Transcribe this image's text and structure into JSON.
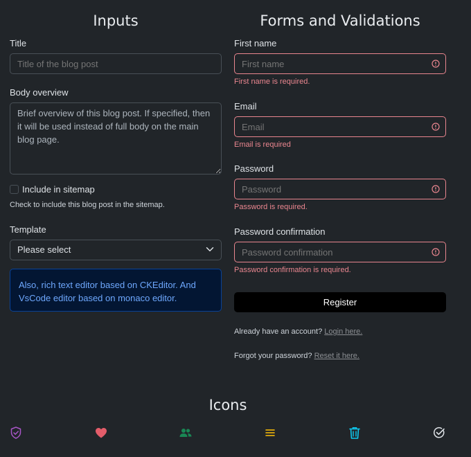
{
  "inputs": {
    "heading": "Inputs",
    "title_label": "Title",
    "title_placeholder": "Title of the blog post",
    "body_label": "Body overview",
    "body_value": "Brief overview of this blog post. If specified, then it will be used instead of full body on the main blog page.",
    "sitemap_label": "Include in sitemap",
    "sitemap_help": "Check to include this blog post in the sitemap.",
    "template_label": "Template",
    "template_selected": "Please select",
    "alert_text": "Also, rich text editor based on CKEditor. And VsCode editor based on monaco editor."
  },
  "forms": {
    "heading": "Forms and Validations",
    "first_name_label": "First name",
    "first_name_placeholder": "First name",
    "first_name_error": "First name is required.",
    "email_label": "Email",
    "email_placeholder": "Email",
    "email_error": "Email is required",
    "password_label": "Password",
    "password_placeholder": "Password",
    "password_error": "Password is required.",
    "confirm_label": "Password confirmation",
    "confirm_placeholder": "Password confirmation",
    "confirm_error": "Password confirmation is required.",
    "register_label": "Register",
    "account_text": "Already have an account?",
    "login_link": "Login here.",
    "forgot_text": "Forgot your password?",
    "reset_link": "Reset it here."
  },
  "icons": {
    "heading": "Icons",
    "items": [
      {
        "name": "shield-check-icon",
        "color": "#a855c7"
      },
      {
        "name": "heart-icon",
        "color": "#e35d6a"
      },
      {
        "name": "people-icon",
        "color": "#198754"
      },
      {
        "name": "list-icon",
        "color": "#ffc107"
      },
      {
        "name": "trash-icon",
        "color": "#0dcaf0"
      },
      {
        "name": "check-circle-icon",
        "color": "#dee2e6"
      }
    ]
  },
  "colors": {
    "background": "#212529",
    "error": "#ea868f",
    "alert_bg": "#031633",
    "alert_text": "#6ea8fe"
  }
}
